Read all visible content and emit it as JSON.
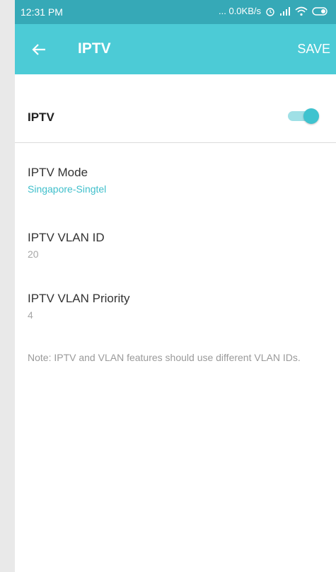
{
  "status_bar": {
    "time": "12:31 PM",
    "network_speed": "... 0.0KB/s",
    "icons": [
      "alarm-icon",
      "signal-icon",
      "wifi-icon",
      "battery-icon"
    ]
  },
  "app_bar": {
    "title": "IPTV",
    "save_label": "SAVE",
    "back_icon": "arrow-left-icon"
  },
  "iptv_toggle": {
    "label": "IPTV",
    "enabled": true
  },
  "fields": {
    "mode": {
      "label": "IPTV Mode",
      "value": "Singapore-Singtel"
    },
    "vlan_id": {
      "label": "IPTV VLAN ID",
      "value": "20"
    },
    "vlan_priority": {
      "label": "IPTV VLAN Priority",
      "value": "4"
    }
  },
  "note": "Note: IPTV and VLAN features should use different VLAN IDs.",
  "colors": {
    "appbar": "#4ccbd6",
    "statusbar": "#36a9b7",
    "accent": "#3fbfcb"
  }
}
